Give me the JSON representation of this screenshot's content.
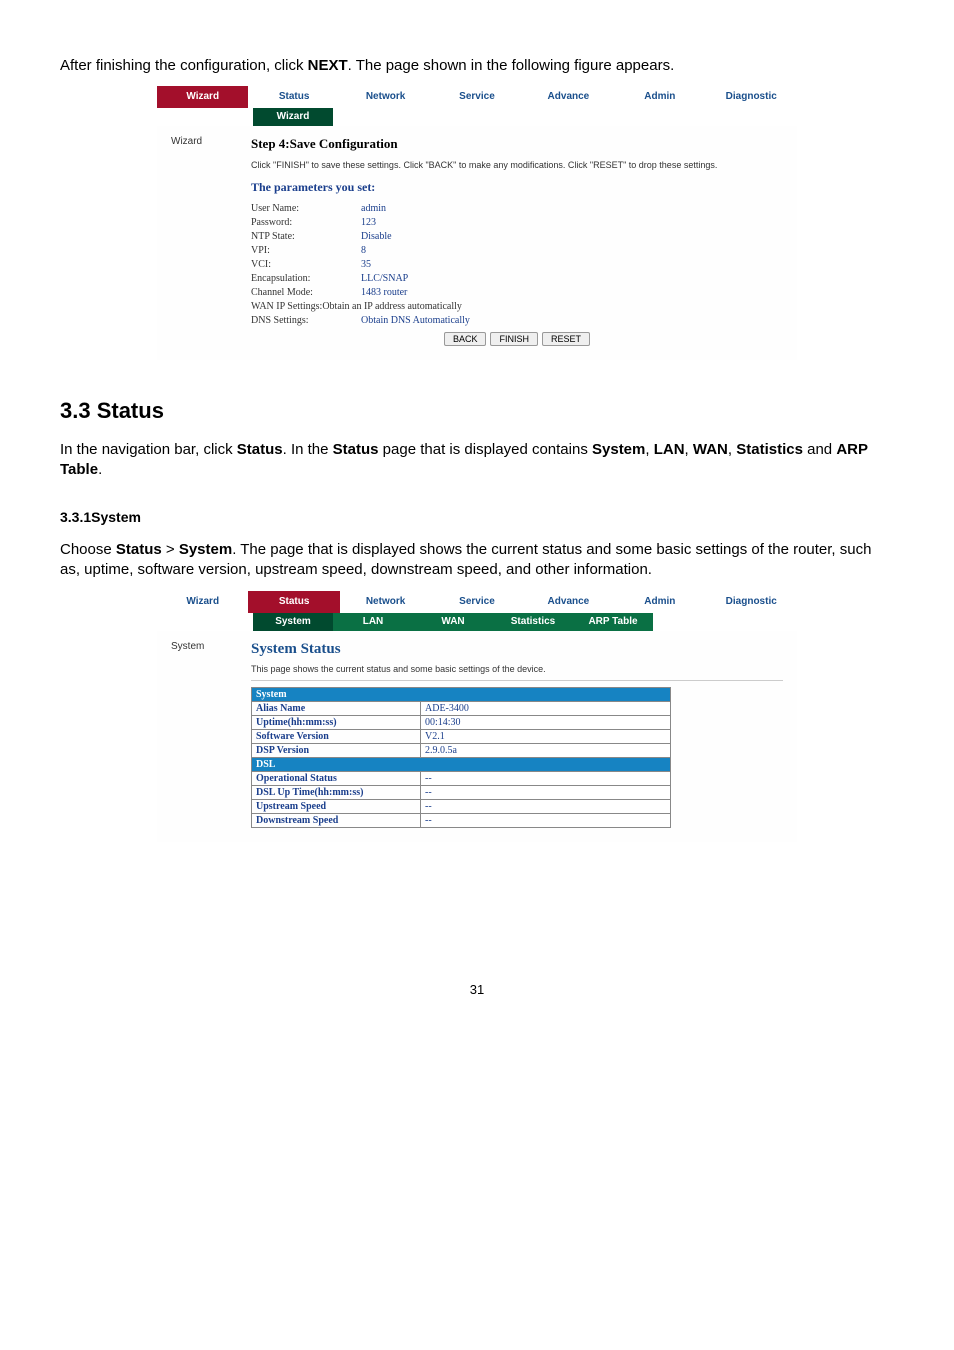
{
  "intro1": "After finishing the configuration, click ",
  "intro1_bold": "NEXT",
  "intro1_tail": ". The page shown in the following figure appears.",
  "shot1": {
    "topnav": [
      "Wizard",
      "Status",
      "Network",
      "Service",
      "Advance",
      "Admin",
      "Diagnostic"
    ],
    "active": 0,
    "sub_left_label": "Wizard",
    "sub_tabs": [
      "Wizard"
    ],
    "left_col_label": "Wizard",
    "step_title": "Step 4:Save Configuration",
    "note": "Click \"FINISH\" to save these settings. Click \"BACK\" to make any modifications. Click \"RESET\" to drop these settings.",
    "params_title": "The parameters you set:",
    "rows": [
      {
        "k": "User Name:",
        "v": "admin"
      },
      {
        "k": "Password:",
        "v": "123"
      },
      {
        "k": "NTP State:",
        "v": "Disable"
      },
      {
        "k": "VPI:",
        "v": "8"
      },
      {
        "k": "VCI:",
        "v": "35"
      },
      {
        "k": "Encapsulation:",
        "v": "LLC/SNAP"
      },
      {
        "k": "Channel Mode:",
        "v": "1483 router"
      },
      {
        "k": "WAN IP Settings:",
        "v": "Obtain an IP address automatically",
        "blacklabel": true
      },
      {
        "k": "DNS Settings:",
        "v": "Obtain DNS Automatically"
      }
    ],
    "buttons": [
      "BACK",
      "FINISH",
      "RESET"
    ]
  },
  "h2_num": "3.3 Status",
  "status_para_pre": "In the navigation bar, click ",
  "status_para_b1": "Status",
  "status_para_mid1": ". In the ",
  "status_para_b2": "Status",
  "status_para_mid2": " page that is displayed contains ",
  "status_para_b3": "System",
  "status_para_sep1": ", ",
  "status_para_b4": "LAN",
  "status_para_sep2": ", ",
  "status_para_b5": "WAN",
  "status_para_sep3": ", ",
  "status_para_b6": "Statistics",
  "status_para_and": " and ",
  "status_para_b7": "ARP Table",
  "status_para_end": ".",
  "h3": "3.3.1System",
  "sys_para_pre": "Choose ",
  "sys_b1": "Status",
  "sys_gt": " > ",
  "sys_b2": "System",
  "sys_tail": ". The page that is displayed shows the current status and some basic settings of the router, such as, uptime, software version, upstream speed, downstream speed, and other information.",
  "shot2": {
    "topnav": [
      "Wizard",
      "Status",
      "Network",
      "Service",
      "Advance",
      "Admin",
      "Diagnostic"
    ],
    "active": 1,
    "sub_left_label": "System",
    "sub_tabs": [
      "System",
      "LAN",
      "WAN",
      "Statistics",
      "ARP Table"
    ],
    "left_col_label": "System",
    "title": "System Status",
    "desc": "This page shows the current status and some basic settings of the device.",
    "groups": [
      {
        "header": "System",
        "rows": [
          {
            "k": "Alias Name",
            "v": "ADE-3400"
          },
          {
            "k": "Uptime(hh:mm:ss)",
            "v": "00:14:30"
          },
          {
            "k": "Software Version",
            "v": "V2.1"
          },
          {
            "k": "DSP Version",
            "v": "2.9.0.5a"
          }
        ]
      },
      {
        "header": "DSL",
        "rows": [
          {
            "k": "Operational Status",
            "v": "--"
          },
          {
            "k": "DSL Up Time(hh:mm:ss)",
            "v": "--"
          },
          {
            "k": "Upstream Speed",
            "v": "--"
          },
          {
            "k": "Downstream Speed",
            "v": "--"
          }
        ]
      }
    ]
  },
  "page_number": "31"
}
